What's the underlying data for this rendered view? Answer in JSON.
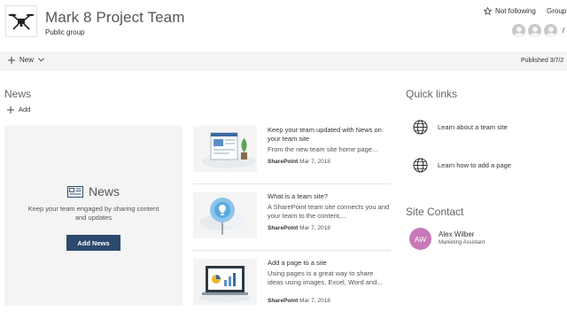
{
  "header": {
    "site_title": "Mark 8 Project Team",
    "site_subtitle": "Public group",
    "follow_label": "Not following",
    "group_label": "Group",
    "members_overflow": "/",
    "logo_icon": "drone-logo"
  },
  "command_bar": {
    "new_label": "New",
    "published_label": "Published 3/7/2"
  },
  "news": {
    "section_title": "News",
    "add_label": "Add",
    "hero": {
      "heading": "News",
      "description": "Keep your team engaged by sharing content and updates",
      "button_label": "Add News"
    },
    "items": [
      {
        "title": "Keep your team updated with News on your team site",
        "description": "From the new team site home page...",
        "author": "SharePoint",
        "date": "Mar 7, 2018"
      },
      {
        "title": "What is a team site?",
        "description": "A SharePoint team site connects you and your team to the content,...",
        "author": "SharePoint",
        "date": "Mar 7, 2018"
      },
      {
        "title": "Add a page to a site",
        "description": "Using pages is a great way to share ideas using images, Excel, Word and...",
        "author": "SharePoint",
        "date": "Mar 7, 2018"
      }
    ]
  },
  "quick_links": {
    "section_title": "Quick links",
    "items": [
      {
        "label": "Learn about a team site",
        "icon": "globe-icon"
      },
      {
        "label": "Learn how to add a page",
        "icon": "globe-icon"
      }
    ]
  },
  "site_contact": {
    "section_title": "Site Contact",
    "initials": "AW",
    "name": "Alex Wilber",
    "role": "Marketing Assistant",
    "avatar_color": "#c879b8"
  },
  "colors": {
    "accent_button": "#2b4a6d",
    "command_bar_bg": "#f4f4f4"
  }
}
